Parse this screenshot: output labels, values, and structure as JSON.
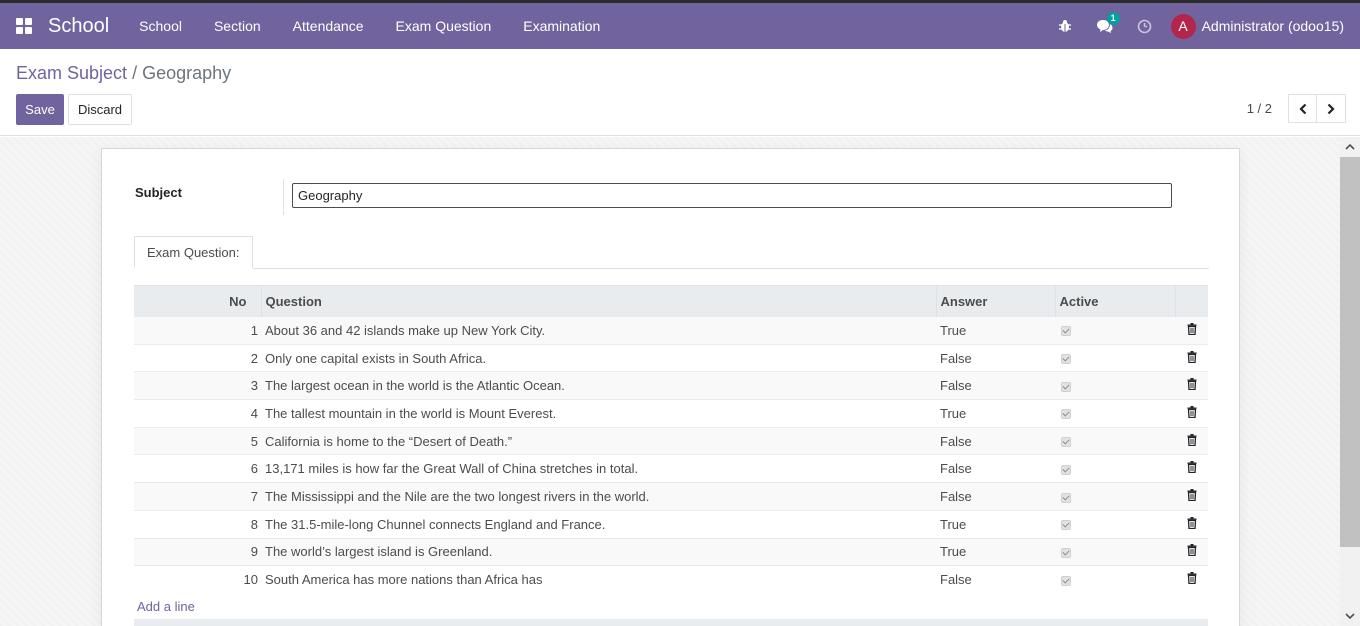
{
  "app": {
    "brand": "School"
  },
  "nav": {
    "items": [
      "School",
      "Section",
      "Attendance",
      "Exam Question",
      "Examination"
    ]
  },
  "systray": {
    "messages_count": "1",
    "user_initial": "A",
    "user_name": "Administrator (odoo15)"
  },
  "breadcrumb": {
    "parent": "Exam Subject",
    "separator": "/",
    "current": "Geography"
  },
  "buttons": {
    "save": "Save",
    "discard": "Discard"
  },
  "pager": {
    "value": "1 / 2"
  },
  "form": {
    "subject_label": "Subject",
    "subject_value": "Geography",
    "tab_label": "Exam Question:"
  },
  "table": {
    "headers": {
      "no": "No",
      "question": "Question",
      "answer": "Answer",
      "active": "Active"
    },
    "rows": [
      {
        "no": "1",
        "question": "About 36 and 42 islands make up New York City.",
        "answer": "True"
      },
      {
        "no": "2",
        "question": "Only one capital exists in South Africa.",
        "answer": "False"
      },
      {
        "no": "3",
        "question": "The largest ocean in the world is the Atlantic Ocean.",
        "answer": "False"
      },
      {
        "no": "4",
        "question": "The tallest mountain in the world is Mount Everest.",
        "answer": "True"
      },
      {
        "no": "5",
        "question": "California is home to the “Desert of Death.”",
        "answer": "False"
      },
      {
        "no": "6",
        "question": "13,171 miles is how far the Great Wall of China stretches in total.",
        "answer": "False"
      },
      {
        "no": "7",
        "question": "The Mississippi and the Nile are the two longest rivers in the world.",
        "answer": "False"
      },
      {
        "no": "8",
        "question": "The 31.5-mile-long Chunnel connects England and France.",
        "answer": "True"
      },
      {
        "no": "9",
        "question": "The world’s largest island is Greenland.",
        "answer": "True"
      },
      {
        "no": "10",
        "question": "South America has more nations than Africa has",
        "answer": "False"
      }
    ],
    "add_line": "Add a line"
  },
  "colors": {
    "brand": "#71639e",
    "avatar": "#b3254b",
    "badge": "#00a09d"
  }
}
